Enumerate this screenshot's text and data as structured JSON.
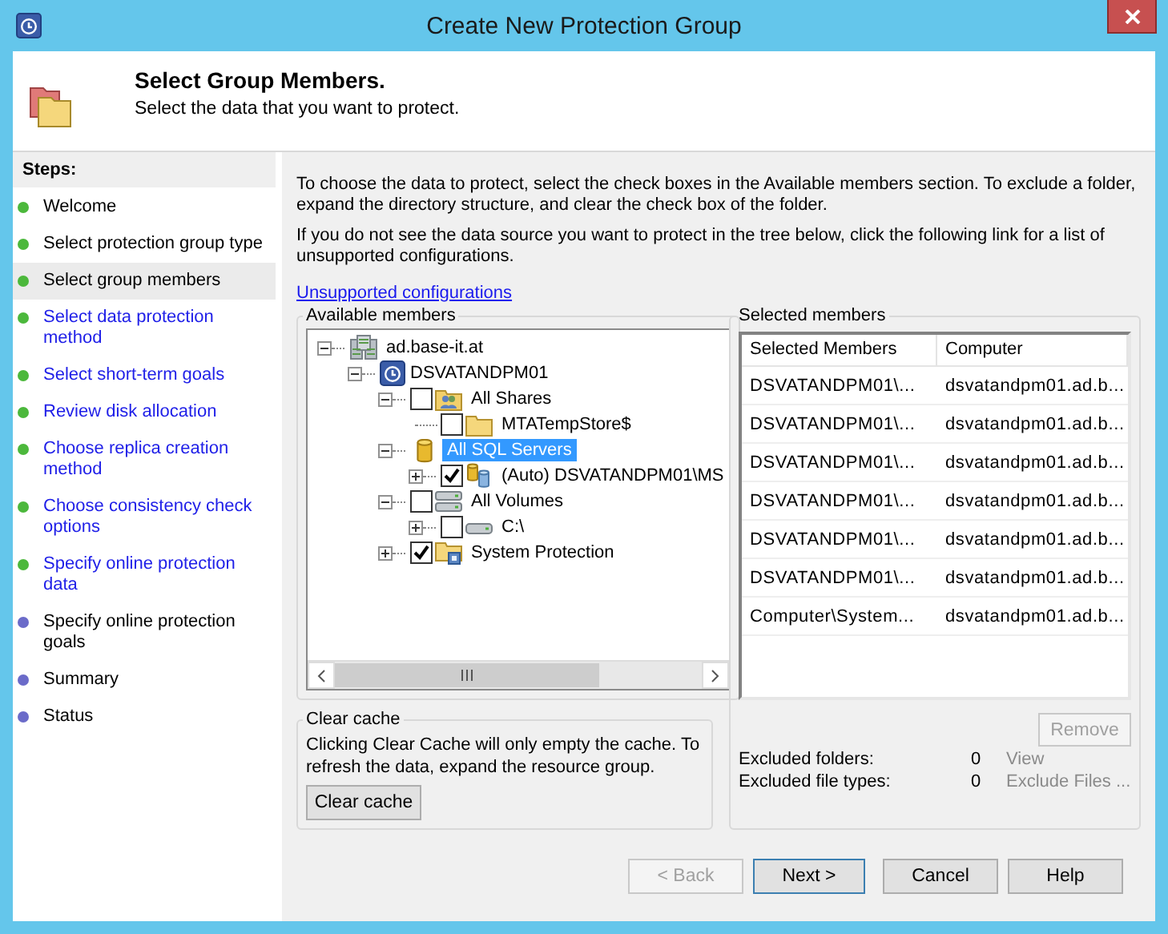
{
  "window": {
    "title": "Create New Protection Group"
  },
  "header": {
    "title": "Select Group Members.",
    "subtitle": "Select the data that you want to protect."
  },
  "steps": {
    "title": "Steps:",
    "items": [
      {
        "label": "Welcome",
        "color": "#4cb83c",
        "link": false,
        "selected": false
      },
      {
        "label": "Select protection group type",
        "color": "#4cb83c",
        "link": false,
        "selected": false
      },
      {
        "label": "Select group members",
        "color": "#4cb83c",
        "link": false,
        "selected": true
      },
      {
        "label": "Select data protection method",
        "color": "#4cb83c",
        "link": true,
        "selected": false
      },
      {
        "label": "Select short-term goals",
        "color": "#4cb83c",
        "link": true,
        "selected": false
      },
      {
        "label": "Review disk allocation",
        "color": "#4cb83c",
        "link": true,
        "selected": false
      },
      {
        "label": "Choose replica creation method",
        "color": "#4cb83c",
        "link": true,
        "selected": false
      },
      {
        "label": "Choose consistency check options",
        "color": "#4cb83c",
        "link": true,
        "selected": false
      },
      {
        "label": "Specify online protection data",
        "color": "#4cb83c",
        "link": true,
        "selected": false
      },
      {
        "label": "Specify online protection goals",
        "color": "#6b6bc9",
        "link": false,
        "selected": false
      },
      {
        "label": "Summary",
        "color": "#6b6bc9",
        "link": false,
        "selected": false
      },
      {
        "label": "Status",
        "color": "#6b6bc9",
        "link": false,
        "selected": false
      }
    ]
  },
  "intro": [
    "To choose the data to protect, select the check boxes in the Available members section. To exclude a folder, expand the directory structure, and clear the check box of the folder.",
    "If you do not see the data source you want to protect in the tree below, click the following link for a list of unsupported configurations."
  ],
  "link": "Unsupported configurations",
  "available": {
    "title": "Available members",
    "tree": [
      {
        "kind": "domain",
        "label": "ad.base-it.at",
        "expanded": true,
        "selected": false,
        "children": [
          {
            "kind": "server",
            "label": "DSVATANDPM01",
            "expanded": true,
            "selected": false,
            "children": [
              {
                "kind": "shares",
                "label": "All Shares",
                "checked": false,
                "expanded": true,
                "selected": false,
                "children": [
                  {
                    "kind": "folder",
                    "label": "MTATempStore$",
                    "checked": false,
                    "selected": false
                  }
                ]
              },
              {
                "kind": "sql",
                "label": "All SQL Servers",
                "expanded": true,
                "selected": true,
                "children": [
                  {
                    "kind": "database",
                    "label": "(Auto) DSVATANDPM01\\MS",
                    "checked": true,
                    "expanded": false,
                    "selected": false
                  }
                ]
              },
              {
                "kind": "volumes",
                "label": "All Volumes",
                "checked": false,
                "expanded": true,
                "selected": false,
                "children": [
                  {
                    "kind": "drive",
                    "label": "C:\\",
                    "checked": false,
                    "expanded": false,
                    "selected": false
                  }
                ]
              },
              {
                "kind": "system",
                "label": "System Protection",
                "checked": true,
                "expanded": false,
                "selected": false
              }
            ]
          }
        ]
      }
    ]
  },
  "clear_cache": {
    "title": "Clear cache",
    "text": "Clicking Clear Cache will only empty the cache. To refresh the data, expand the resource group.",
    "button": "Clear cache"
  },
  "selected_members": {
    "title": "Selected members",
    "columns": [
      "Selected Members",
      "Computer"
    ],
    "rows": [
      [
        "DSVATANDPM01\\...",
        "dsvatandpm01.ad.b..."
      ],
      [
        "DSVATANDPM01\\...",
        "dsvatandpm01.ad.b..."
      ],
      [
        "DSVATANDPM01\\...",
        "dsvatandpm01.ad.b..."
      ],
      [
        "DSVATANDPM01\\...",
        "dsvatandpm01.ad.b..."
      ],
      [
        "DSVATANDPM01\\...",
        "dsvatandpm01.ad.b..."
      ],
      [
        "DSVATANDPM01\\...",
        "dsvatandpm01.ad.b..."
      ],
      [
        "Computer\\System...",
        "dsvatandpm01.ad.b..."
      ]
    ],
    "remove": {
      "label": "Remove",
      "disabled": true
    },
    "exclusions": [
      {
        "label": "Excluded folders:",
        "count": "0",
        "action": "View",
        "disabled": true
      },
      {
        "label": "Excluded file types:",
        "count": "0",
        "action": "Exclude Files ...",
        "disabled": true
      }
    ]
  },
  "buttons": [
    {
      "label": "< Back",
      "disabled": true,
      "default": false
    },
    {
      "label": "Next >",
      "disabled": false,
      "default": true
    },
    {
      "label": "Cancel",
      "disabled": false,
      "default": false
    },
    {
      "label": "Help",
      "disabled": false,
      "default": false
    }
  ]
}
